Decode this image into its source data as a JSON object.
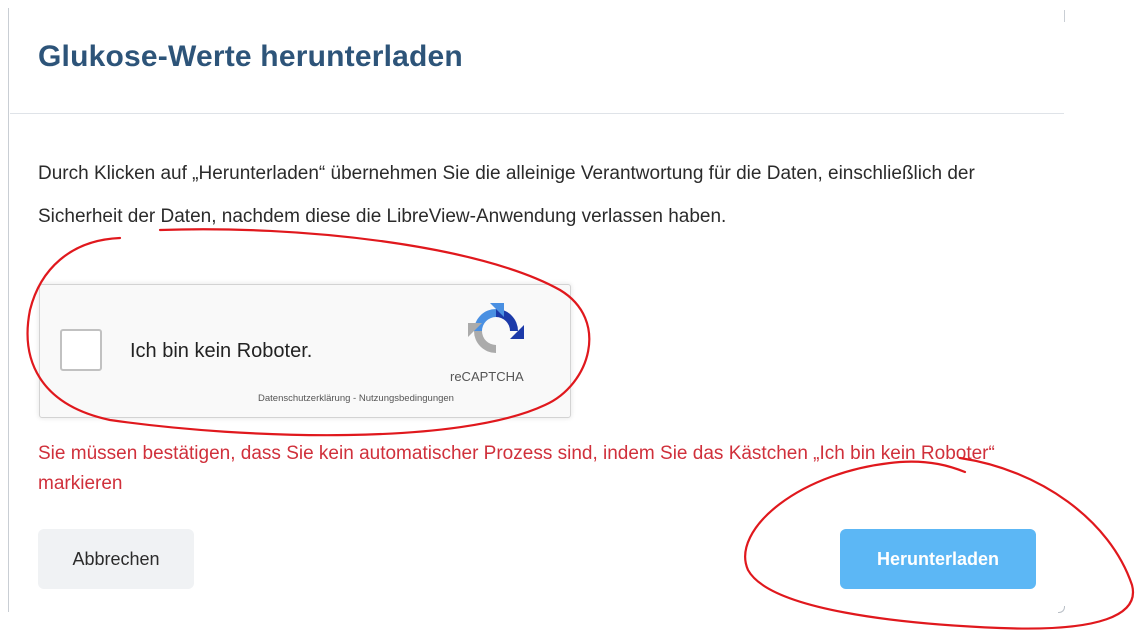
{
  "dialog": {
    "title": "Glukose-Werte herunterladen",
    "description": "Durch Klicken auf „Herunterladen“ übernehmen Sie die alleinige Verantwortung für die Daten, einschließlich der Sicherheit der Daten, nachdem diese die LibreView-Anwendung verlassen haben."
  },
  "captcha": {
    "checkbox_label": "Ich bin kein Roboter.",
    "brand": "reCAPTCHA",
    "privacy_link": "Datenschutzerklärung",
    "separator": " - ",
    "terms_link": "Nutzungsbedingungen",
    "checked": false
  },
  "error": {
    "message": "Sie müssen bestätigen, dass Sie kein automatischer Prozess sind, indem Sie das Kästchen „Ich bin kein Roboter“ markieren"
  },
  "buttons": {
    "cancel_label": "Abbrechen",
    "download_label": "Herunterladen"
  },
  "colors": {
    "title": "#2d5479",
    "error": "#d0303b",
    "download_button": "#5cb7f5",
    "cancel_button": "#f0f2f4",
    "annotation": "#e0181d"
  },
  "icons": {
    "captcha_logo": "recaptcha-logo-icon"
  }
}
